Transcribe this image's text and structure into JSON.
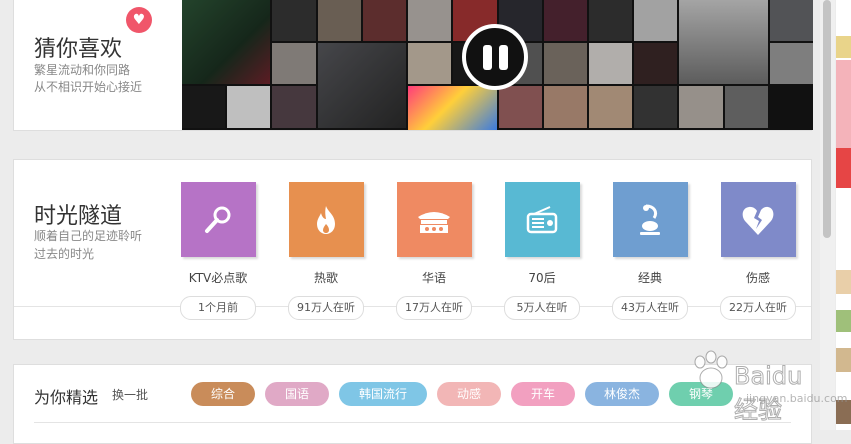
{
  "guess": {
    "title": "猜你喜欢",
    "subtitle_1": "繁星流动和你同路",
    "subtitle_2": "从不相识开始心接近",
    "heart_icon": "heart-icon",
    "player_state": "playing"
  },
  "tunnel": {
    "title": "时光隧道",
    "subtitle_1": "顺着自己的足迹聆听",
    "subtitle_2": "过去的时光",
    "categories": [
      {
        "label": "KTV必点歌",
        "listeners": "1个月前",
        "color": "#b673c6",
        "icon": "microphone-icon"
      },
      {
        "label": "热歌",
        "listeners": "91万人在听",
        "color": "#e7904f",
        "icon": "flame-icon"
      },
      {
        "label": "华语",
        "listeners": "17万人在听",
        "color": "#ef8a62",
        "icon": "pavilion-icon"
      },
      {
        "label": "70后",
        "listeners": "5万人在听",
        "color": "#58b9d3",
        "icon": "radio-icon"
      },
      {
        "label": "经典",
        "listeners": "43万人在听",
        "color": "#6f9ed0",
        "icon": "phonograph-icon"
      },
      {
        "label": "伤感",
        "listeners": "22万人在听",
        "color": "#7f8ac9",
        "icon": "broken-heart-icon"
      }
    ]
  },
  "picks": {
    "title": "为你精选",
    "refresh": "换一批",
    "tags": [
      {
        "label": "综合",
        "color": "#c98c5a"
      },
      {
        "label": "国语",
        "color": "#e0a9c6"
      },
      {
        "label": "韩国流行",
        "color": "#7fc6e6"
      },
      {
        "label": "动感",
        "color": "#f2b6b6"
      },
      {
        "label": "开车",
        "color": "#f2a0c0"
      },
      {
        "label": "林俊杰",
        "color": "#8ab4e0"
      },
      {
        "label": "钢琴",
        "color": "#6fcfae"
      }
    ]
  },
  "watermark": {
    "text": "Baidu 经验",
    "sub": "jingyan.baidu.com"
  }
}
